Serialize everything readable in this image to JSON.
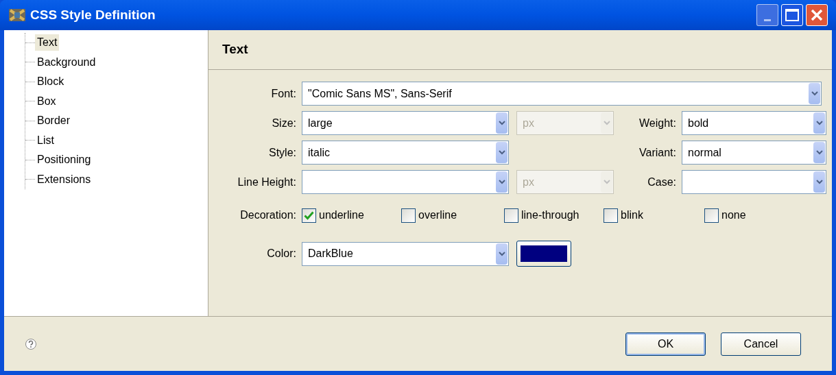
{
  "window": {
    "title": "CSS Style Definition"
  },
  "tree": {
    "items": [
      {
        "label": "Text",
        "selected": true
      },
      {
        "label": "Background",
        "selected": false
      },
      {
        "label": "Block",
        "selected": false
      },
      {
        "label": "Box",
        "selected": false
      },
      {
        "label": "Border",
        "selected": false
      },
      {
        "label": "List",
        "selected": false
      },
      {
        "label": "Positioning",
        "selected": false
      },
      {
        "label": "Extensions",
        "selected": false
      }
    ]
  },
  "section_title": "Text",
  "font": {
    "label": "Font:",
    "value": "\"Comic Sans MS\", Sans-Serif"
  },
  "size": {
    "label": "Size:",
    "value": "large",
    "unit": {
      "value": "px",
      "disabled": true
    }
  },
  "weight": {
    "label": "Weight:",
    "value": "bold"
  },
  "style": {
    "label": "Style:",
    "value": "italic"
  },
  "variant": {
    "label": "Variant:",
    "value": "normal"
  },
  "line_height": {
    "label": "Line Height:",
    "unit": {
      "value": "px",
      "disabled": true
    }
  },
  "case": {
    "label": "Case:"
  },
  "decoration": {
    "label": "Decoration:",
    "options": [
      {
        "label": "underline",
        "checked": true
      },
      {
        "label": "overline",
        "checked": false
      },
      {
        "label": "line-through",
        "checked": false
      },
      {
        "label": "blink",
        "checked": false
      },
      {
        "label": "none",
        "checked": false
      }
    ]
  },
  "color": {
    "label": "Color:",
    "value": "DarkBlue",
    "color": "#000080"
  },
  "buttons": [
    {
      "label": "OK",
      "default": true
    },
    {
      "label": "Cancel",
      "default": false
    }
  ]
}
